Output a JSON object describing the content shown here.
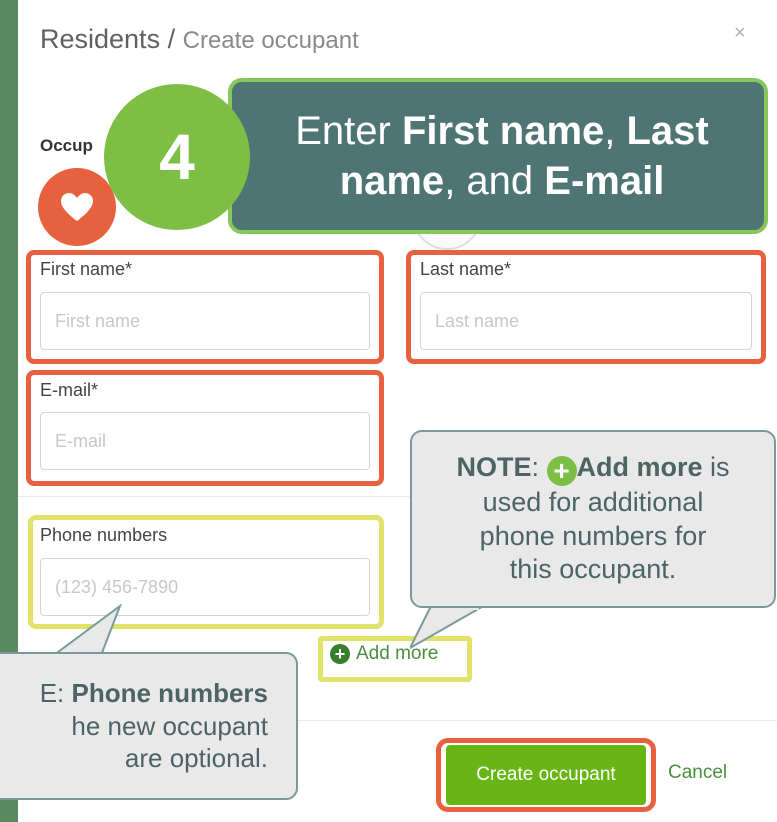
{
  "breadcrumb": {
    "parent": "Residents",
    "separator": "/",
    "current": "Create occupant"
  },
  "close_label": "×",
  "section_label": "Occup",
  "form": {
    "first_name": {
      "label": "First name*",
      "placeholder": "First name"
    },
    "last_name": {
      "label": "Last name*",
      "placeholder": "Last name"
    },
    "email": {
      "label": "E-mail*",
      "placeholder": "E-mail"
    },
    "phone": {
      "label": "Phone numbers",
      "placeholder": "(123) 456-7890"
    },
    "add_more_label": "Add more"
  },
  "buttons": {
    "create": "Create occupant",
    "cancel": "Cancel"
  },
  "callouts": {
    "step_number": "4",
    "step_text_1": "Enter ",
    "step_bold_1": "First name",
    "step_text_2": ", ",
    "step_bold_2": "Last name",
    "step_text_3": ", and ",
    "step_bold_3": "E-mail",
    "note_prefix": "NOTE",
    "note_colon": ":",
    "note_bold": "Add more",
    "note_text_1": " is",
    "note_text_2": "used for additional",
    "note_text_3": "phone numbers for",
    "note_text_4": "this occupant.",
    "note2_line1_prefix": "E: ",
    "note2_line1_bold": "Phone numbers",
    "note2_line2": "he new occupant",
    "note2_line3": "are optional."
  },
  "colors": {
    "accent_orange": "#e8613e",
    "accent_yellow": "#dfe36a",
    "brand_green": "#6ab516"
  },
  "icons": {
    "heart": "heart-icon",
    "plus": "plus-circle-icon",
    "close": "close-icon"
  }
}
